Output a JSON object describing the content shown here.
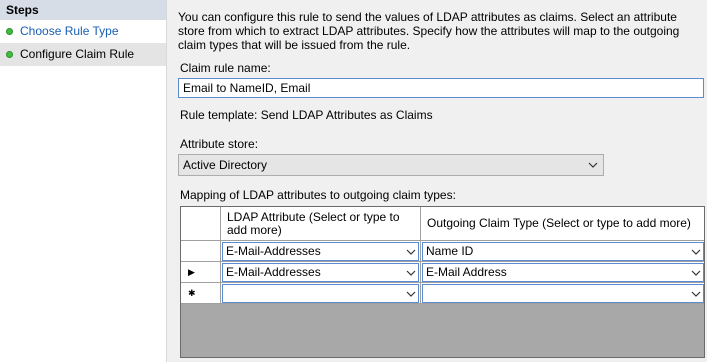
{
  "sidebar": {
    "title": "Steps",
    "items": [
      {
        "label": "Choose Rule Type"
      },
      {
        "label": "Configure Claim Rule"
      }
    ]
  },
  "intro_text": "You can configure this rule to send the values of LDAP attributes as claims. Select an attribute store from which to extract LDAP attributes. Specify how the attributes will map to the outgoing claim types that will be issued from the rule.",
  "claim_rule_name": {
    "label": "Claim rule name:",
    "value": "Email to NameID, Email"
  },
  "rule_template": "Rule template: Send LDAP Attributes as Claims",
  "attribute_store": {
    "label": "Attribute store:",
    "value": "Active Directory"
  },
  "mapping": {
    "label": "Mapping of LDAP attributes to outgoing claim types:",
    "columns": [
      "LDAP Attribute (Select or type to add more)",
      "Outgoing Claim Type (Select or type to add more)"
    ],
    "rows": [
      {
        "marker": "",
        "ldap": "E-Mail-Addresses",
        "claim": "Name ID"
      },
      {
        "marker": "▶",
        "ldap": "E-Mail-Addresses",
        "claim": "E-Mail Address"
      },
      {
        "marker": "✱",
        "ldap": "",
        "claim": ""
      }
    ]
  }
}
